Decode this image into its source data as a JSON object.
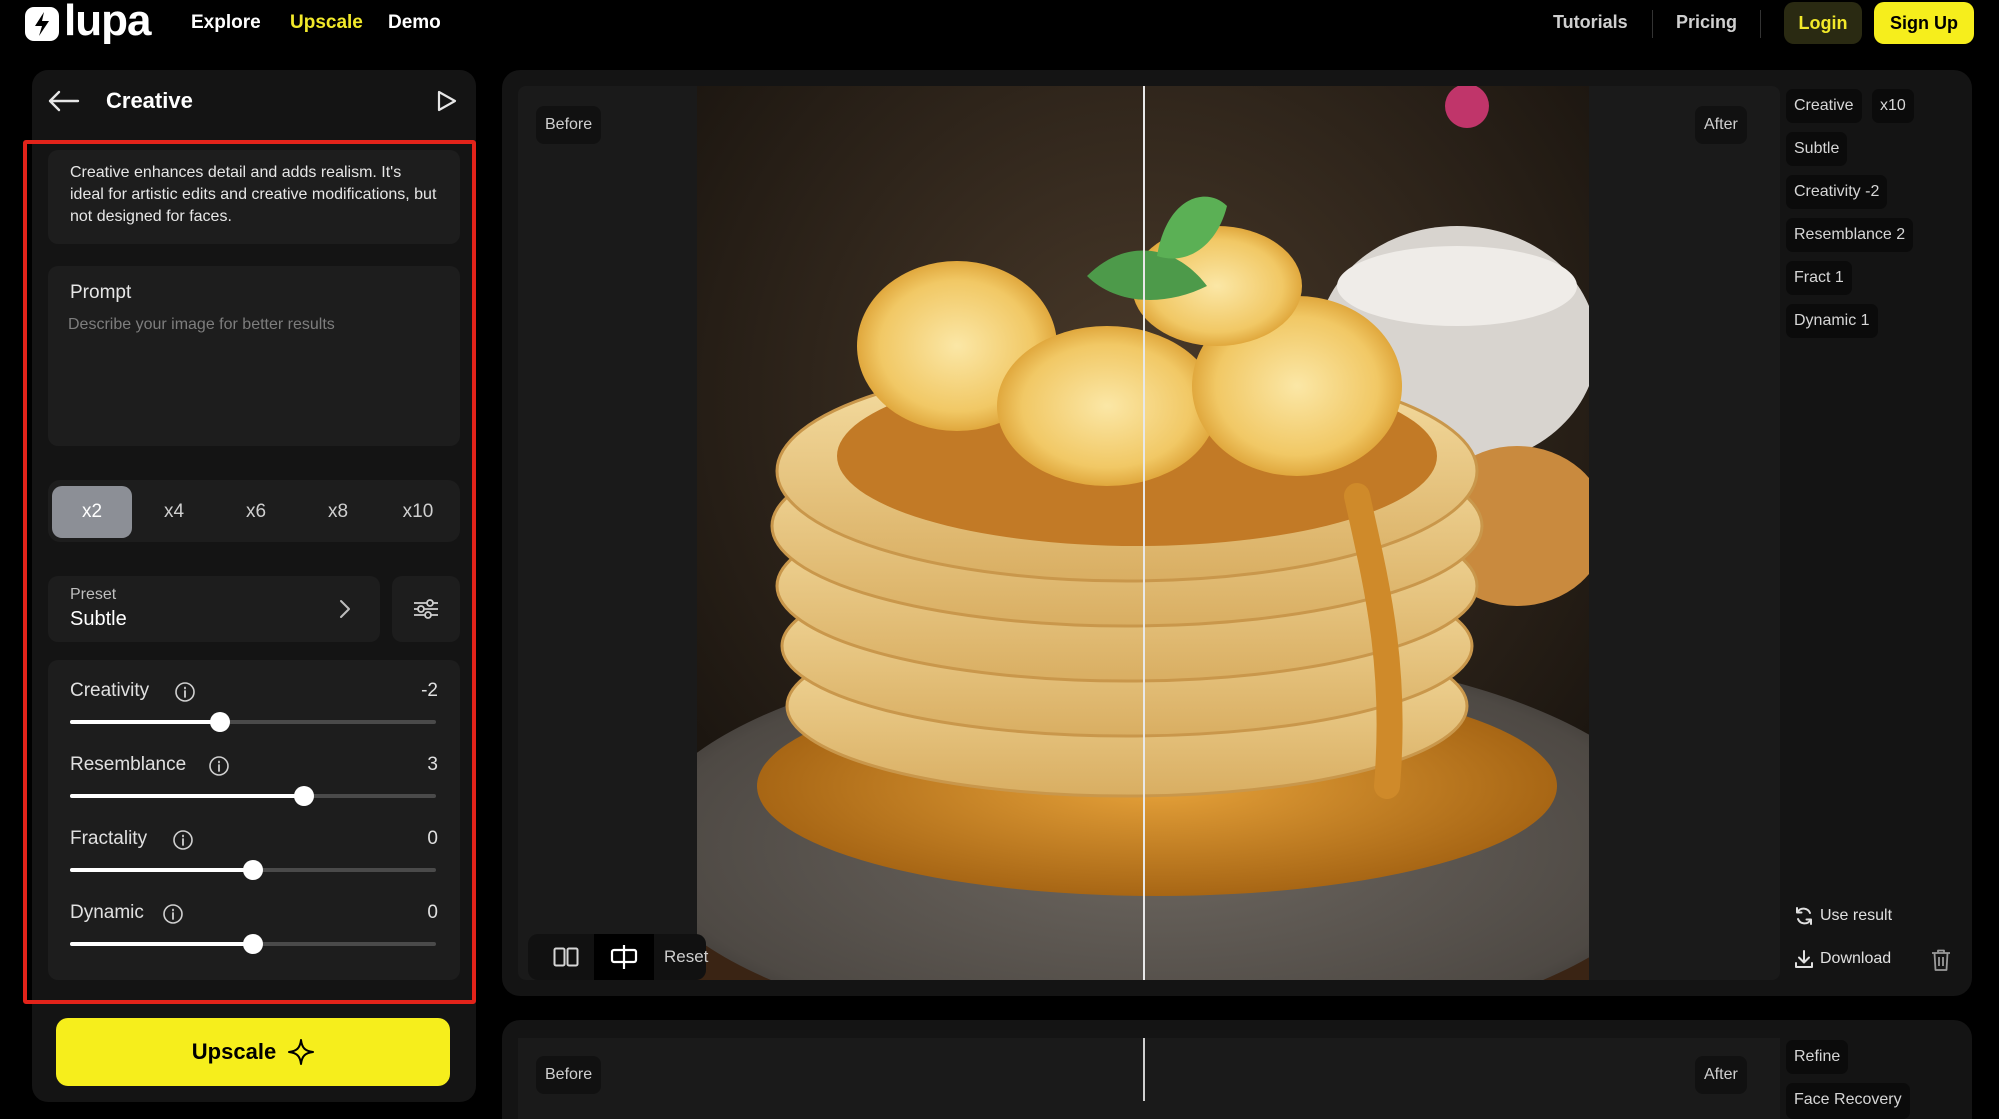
{
  "nav": {
    "logo": "lupa",
    "links": [
      "Explore",
      "Upscale",
      "Demo"
    ],
    "active_link": "Upscale",
    "right_links": [
      "Tutorials",
      "Pricing"
    ],
    "login": "Login",
    "signup": "Sign Up"
  },
  "panel": {
    "title": "Creative",
    "description": "Creative enhances detail and adds realism. It's ideal for artistic edits and creative modifications, but not designed for faces.",
    "prompt_label": "Prompt",
    "prompt_placeholder": "Describe your image for better results",
    "scales": [
      "x2",
      "x4",
      "x6",
      "x8",
      "x10"
    ],
    "active_scale": "x2",
    "preset_label": "Preset",
    "preset_value": "Subtle",
    "sliders": [
      {
        "label": "Creativity",
        "value": "-2",
        "position": 0.41
      },
      {
        "label": "Resemblance",
        "value": "3",
        "position": 0.64
      },
      {
        "label": "Fractality",
        "value": "0",
        "position": 0.5
      },
      {
        "label": "Dynamic",
        "value": "0",
        "position": 0.5
      }
    ],
    "upscale_button": "Upscale"
  },
  "viewer": {
    "before_label": "Before",
    "after_label": "After",
    "reset_label": "Reset",
    "split_position": 0.5
  },
  "result_tags": [
    "Creative",
    "x10",
    "Subtle",
    "Creativity -2",
    "Resemblance 2",
    "Fract 1",
    "Dynamic 1"
  ],
  "actions": {
    "use_result": "Use result",
    "download": "Download"
  },
  "second_viewer": {
    "before_label": "Before",
    "after_label": "After",
    "tags": [
      "Refine",
      "Face Recovery"
    ]
  },
  "colors": {
    "accent_yellow": "#f6ee1c",
    "highlight_red": "#e2231a",
    "panel_bg": "#141414"
  }
}
